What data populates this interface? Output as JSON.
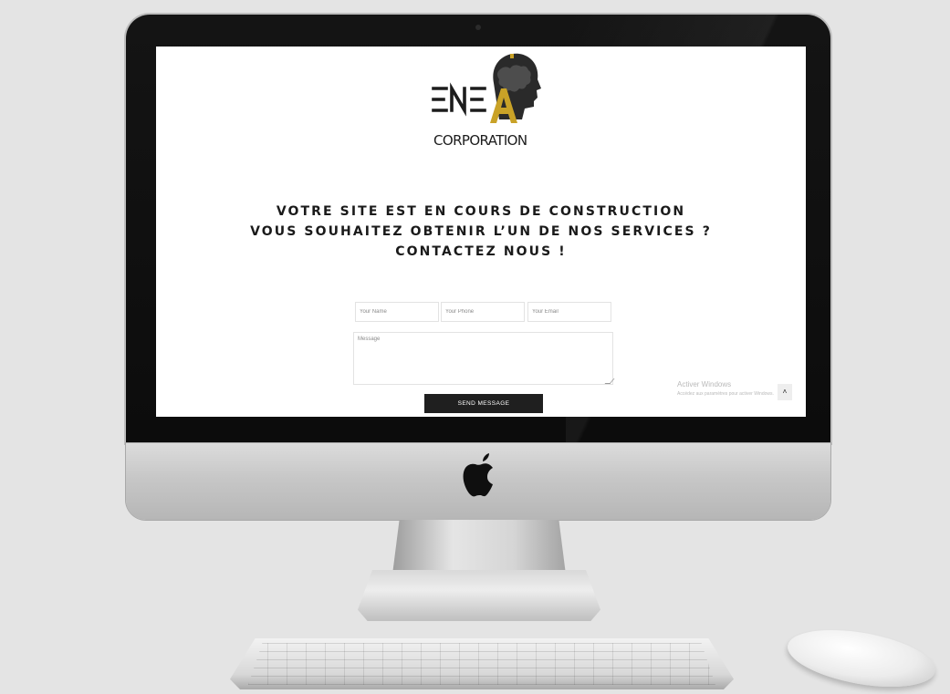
{
  "brand": {
    "logo_top": "ENEA",
    "logo_bottom": "CORPORATION"
  },
  "headline": {
    "line1": "VOTRE SITE EST EN COURS DE CONSTRUCTION",
    "line2": "VOUS SOUHAITEZ OBTENIR L’UN DE NOS SERVICES ?",
    "line3": "CONTACTEZ NOUS !"
  },
  "form": {
    "name_placeholder": "Your Name",
    "phone_placeholder": "Your Phone",
    "email_placeholder": "Your Email",
    "message_placeholder": "Message",
    "submit_label": "SEND MESSAGE"
  },
  "watermark": {
    "title": "Activer Windows",
    "subtitle": "Accédez aux paramètres pour activer Windows."
  },
  "scroll_top": {
    "icon": "chevron-up-icon",
    "glyph": "˄"
  },
  "colors": {
    "accent_gold": "#c9a227",
    "button_bg": "#1f1f1f",
    "text_dark": "#1a1a1a"
  }
}
